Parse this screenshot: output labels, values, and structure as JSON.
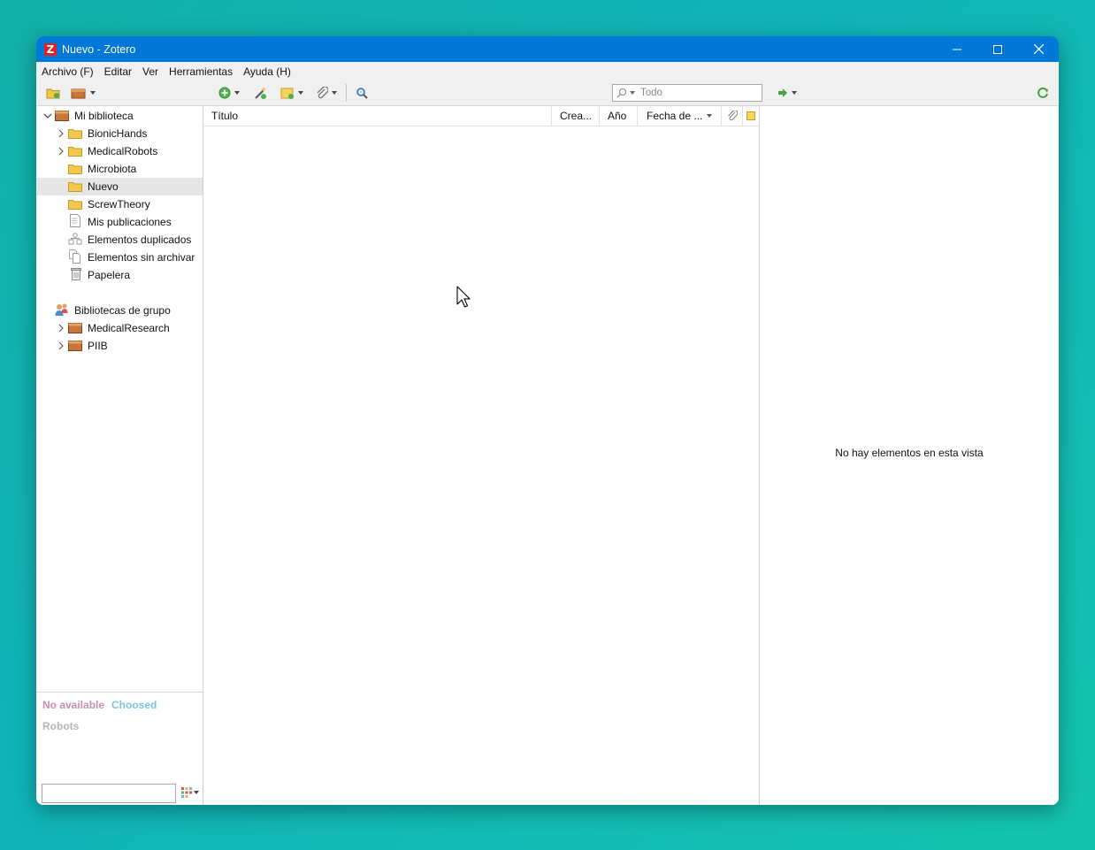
{
  "window": {
    "title": "Nuevo - Zotero",
    "logo_letter": "Z"
  },
  "menu": [
    "Archivo (F)",
    "Editar",
    "Ver",
    "Herramientas",
    "Ayuda (H)"
  ],
  "toolbar": {
    "search_placeholder": "Todo"
  },
  "collections": {
    "library": "Mi biblioteca",
    "items": [
      {
        "label": "BionicHands",
        "expandable": true
      },
      {
        "label": "MedicalRobots",
        "expandable": true
      },
      {
        "label": "Microbiota",
        "expandable": false
      },
      {
        "label": "Nuevo",
        "expandable": false,
        "selected": true
      },
      {
        "label": "ScrewTheory",
        "expandable": false
      }
    ],
    "specials": [
      "Mis publicaciones",
      "Elementos duplicados",
      "Elementos sin archivar",
      "Papelera"
    ],
    "group_header": "Bibliotecas de grupo",
    "groups": [
      "MedicalResearch",
      "PIIB"
    ]
  },
  "tags": {
    "items": [
      {
        "label": "No available",
        "color": "#c98fb0"
      },
      {
        "label": "Choosed",
        "color": "#7ec3e6"
      },
      {
        "label": "Robots",
        "color": "#b5b5b5"
      }
    ]
  },
  "columns": [
    "Título",
    "Crea...",
    "Año",
    "Fecha de ..."
  ],
  "item_pane": {
    "empty_message": "No hay elementos en esta vista"
  },
  "colors": {
    "titlebar": "#0078d7",
    "folder": "#f2c94c",
    "library": "#c8763a"
  }
}
